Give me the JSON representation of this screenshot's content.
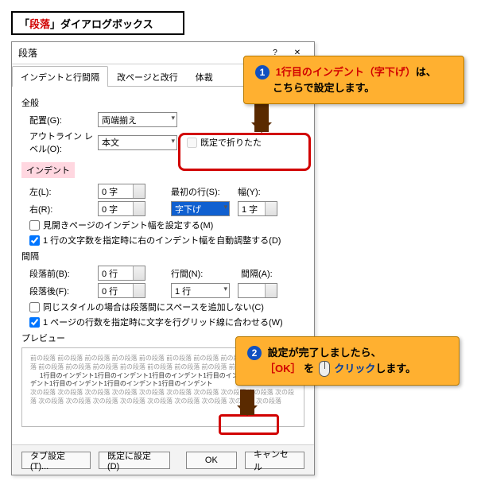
{
  "page_title": {
    "prefix": "「",
    "hl": "段落",
    "suffix": "」ダイアログボックス"
  },
  "dialog": {
    "title": "段落",
    "win_help": "?",
    "win_close": "✕",
    "tabs": [
      "インデントと行間隔",
      "改ページと改行",
      "体裁"
    ],
    "sec_general": "全般",
    "lbl_align": "配置(G):",
    "val_align": "両端揃え",
    "lbl_outline": "アウトライン レベル(O):",
    "val_outline": "本文",
    "chk_collapse": "既定で折りたた",
    "sec_indent": "インデント",
    "lbl_left": "左(L):",
    "val_left": "0 字",
    "lbl_right": "右(R):",
    "val_right": "0 字",
    "lbl_firstline": "最初の行(S):",
    "val_firstline": "字下げ",
    "lbl_width": "幅(Y):",
    "val_width": "1 字",
    "chk_mirror": "見開きページのインデント幅を設定する(M)",
    "chk_autoadjust": "1 行の文字数を指定時に右のインデント幅を自動調整する(D)",
    "sec_spacing": "間隔",
    "lbl_before": "段落前(B):",
    "val_before": "0 行",
    "lbl_lineheight": "行間(N):",
    "val_lineheight": "1 行",
    "lbl_gap": "間隔(A):",
    "val_gap": "",
    "lbl_after": "段落後(F):",
    "val_after": "0 行",
    "chk_samestyle": "同じスタイルの場合は段落間にスペースを追加しない(C)",
    "chk_gridsnap": "1 ページの行数を指定時に文字を行グリッド線に合わせる(W)",
    "sec_preview": "プレビュー",
    "preview_gray": "前の段落 前の段落 前の段落 前の段落 前の段落 前の段落 前の段落 前の段落 前の段落 前の段落 前の段落 前の段落 前の段落 前の段落 前の段落 前の段落 前の段落 前の段落",
    "preview_dark": "1行目のインデント1行目のインデント1行目のインデント1行目のインデント1行目のインデント1行目のインデント1行目のインデント1行目のインデント",
    "preview_gray2": "次の段落 次の段落 次の段落 次の段落 次の段落 次の段落 次の段落 次の段落 次の段落 次の段落 次の段落 次の段落 次の段落 次の段落 次の段落 次の段落 次の段落 次の段落 次の段落",
    "btn_tabset": "タブ設定(T)...",
    "btn_default": "既定に設定(D)",
    "btn_ok": "OK",
    "btn_cancel": "キャンセル"
  },
  "callout1": {
    "num": "1",
    "red": "1行目のインデント（字下げ）",
    "tail1": "は、",
    "line2": "こちらで設定します。"
  },
  "callout2": {
    "num": "2",
    "line1": "設定が完了しましたら、",
    "ok_l": "［",
    "ok": "OK",
    "ok_r": "］",
    "mid": "を ",
    "click": "クリック",
    "tail": "します。"
  }
}
